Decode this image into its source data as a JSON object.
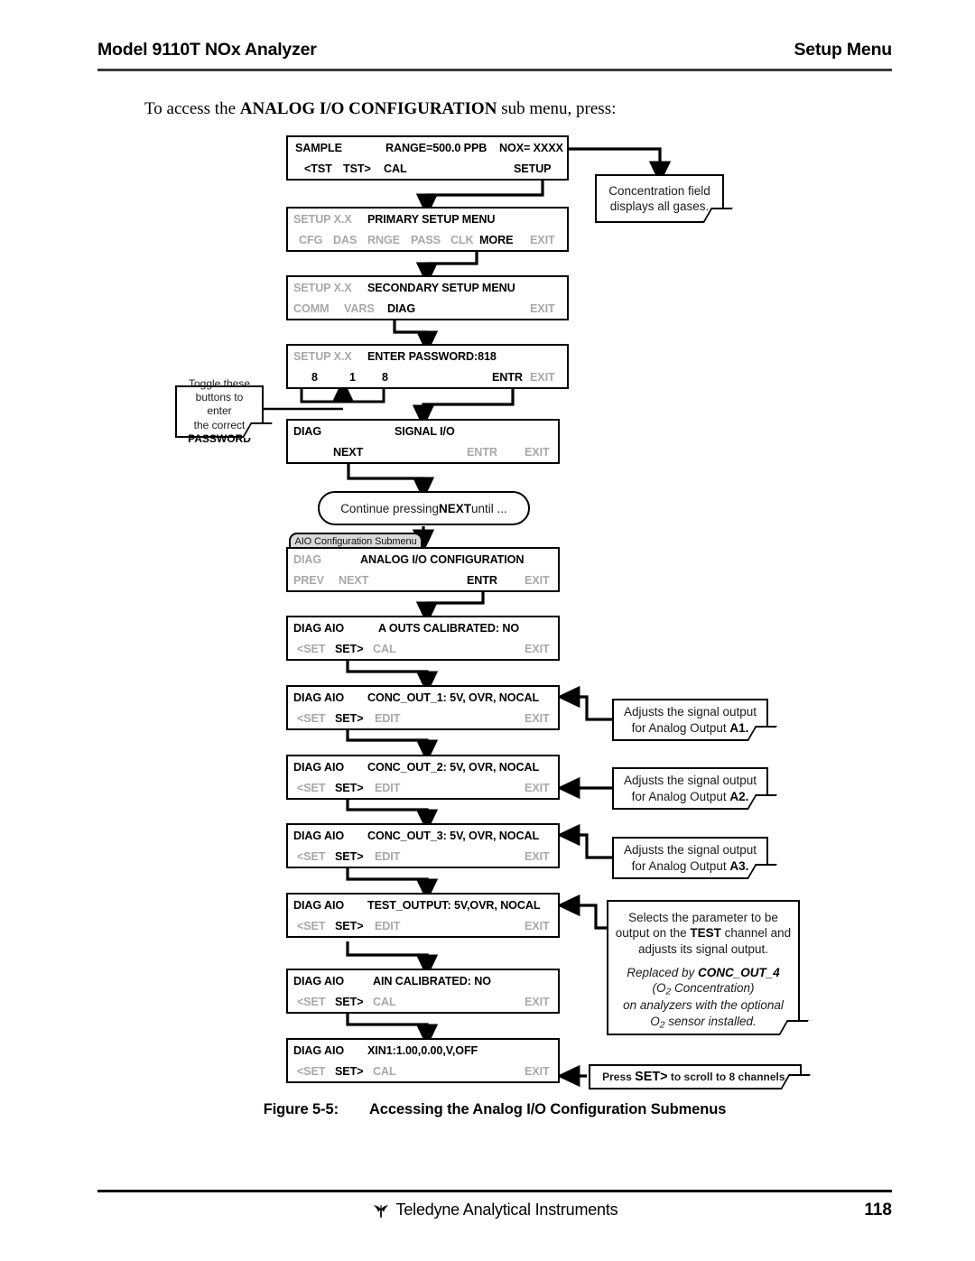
{
  "header": {
    "left_title": "Model 9110T NOx Analyzer",
    "right_title": "Setup Menu"
  },
  "intro": {
    "before": "To access the ",
    "emphasis": "ANALOG I/O CONFIGURATION",
    "after": " sub menu, press:"
  },
  "panels": [
    {
      "id": "sample",
      "top_left": "SAMPLE",
      "top_center": "RANGE=500.0 PPB",
      "top_right": "NOX= XXXX",
      "buttons": [
        {
          "label": "<TST",
          "state": "lit"
        },
        {
          "label": "TST>",
          "state": "lit"
        },
        {
          "label": "CAL",
          "state": "lit"
        },
        {
          "label": "SETUP",
          "state": "lit"
        }
      ]
    },
    {
      "id": "primary-setup",
      "top_left": "SETUP X.X",
      "top_center": "PRIMARY SETUP MENU",
      "buttons": [
        {
          "label": "CFG",
          "state": "dim"
        },
        {
          "label": "DAS",
          "state": "dim"
        },
        {
          "label": "RNGE",
          "state": "dim"
        },
        {
          "label": "PASS",
          "state": "dim"
        },
        {
          "label": "CLK",
          "state": "dim"
        },
        {
          "label": "MORE",
          "state": "lit"
        },
        {
          "label": "EXIT",
          "state": "dim"
        }
      ]
    },
    {
      "id": "secondary-setup",
      "top_left": "SETUP X.X",
      "top_center": "SECONDARY SETUP MENU",
      "buttons": [
        {
          "label": "COMM",
          "state": "dim"
        },
        {
          "label": "VARS",
          "state": "dim"
        },
        {
          "label": "DIAG",
          "state": "lit"
        },
        {
          "label": "EXIT",
          "state": "dim"
        }
      ]
    },
    {
      "id": "enter-password",
      "top_left": "SETUP X.X",
      "top_center": "ENTER PASSWORD:818",
      "digits": [
        "8",
        "1",
        "8"
      ],
      "buttons": [
        {
          "label": "ENTR",
          "state": "lit"
        },
        {
          "label": "EXIT",
          "state": "dim"
        }
      ]
    },
    {
      "id": "signal-io",
      "top_left": "DIAG",
      "top_center": "SIGNAL I/O",
      "buttons": [
        {
          "label": "NEXT",
          "state": "lit"
        },
        {
          "label": "ENTR",
          "state": "dim"
        },
        {
          "label": "EXIT",
          "state": "dim"
        }
      ]
    },
    {
      "id": "analog-io-config",
      "top_left": "DIAG",
      "top_center": "ANALOG I/O CONFIGURATION",
      "tab_label": "AIO Configuration Submenu",
      "buttons": [
        {
          "label": "PREV",
          "state": "dim"
        },
        {
          "label": "NEXT",
          "state": "dim"
        },
        {
          "label": "ENTR",
          "state": "lit"
        },
        {
          "label": "EXIT",
          "state": "dim"
        }
      ]
    },
    {
      "id": "a-outs-calibrated",
      "top_left": "DIAG AIO",
      "top_center": "A OUTS CALIBRATED: NO",
      "buttons": [
        {
          "label": "<SET",
          "state": "dim"
        },
        {
          "label": "SET>",
          "state": "lit"
        },
        {
          "label": "CAL",
          "state": "dim"
        },
        {
          "label": "EXIT",
          "state": "dim"
        }
      ]
    },
    {
      "id": "conc-out-1",
      "top_left": "DIAG AIO",
      "top_center": "CONC_OUT_1: 5V, OVR, NOCAL",
      "buttons": [
        {
          "label": "<SET",
          "state": "dim"
        },
        {
          "label": "SET>",
          "state": "lit"
        },
        {
          "label": "EDIT",
          "state": "dim"
        },
        {
          "label": "EXIT",
          "state": "dim"
        }
      ]
    },
    {
      "id": "conc-out-2",
      "top_left": "DIAG AIO",
      "top_center": "CONC_OUT_2: 5V, OVR, NOCAL",
      "buttons": [
        {
          "label": "<SET",
          "state": "dim"
        },
        {
          "label": "SET>",
          "state": "lit"
        },
        {
          "label": "EDIT",
          "state": "dim"
        },
        {
          "label": "EXIT",
          "state": "dim"
        }
      ]
    },
    {
      "id": "conc-out-3",
      "top_left": "DIAG AIO",
      "top_center": "CONC_OUT_3: 5V, OVR, NOCAL",
      "buttons": [
        {
          "label": "<SET",
          "state": "dim"
        },
        {
          "label": "SET>",
          "state": "lit"
        },
        {
          "label": "EDIT",
          "state": "dim"
        },
        {
          "label": "EXIT",
          "state": "dim"
        }
      ]
    },
    {
      "id": "test-output",
      "top_left": "DIAG AIO",
      "top_center": "TEST_OUTPUT: 5V,OVR, NOCAL",
      "buttons": [
        {
          "label": "<SET",
          "state": "dim"
        },
        {
          "label": "SET>",
          "state": "lit"
        },
        {
          "label": "EDIT",
          "state": "dim"
        },
        {
          "label": "EXIT",
          "state": "dim"
        }
      ]
    },
    {
      "id": "ain-calibrated",
      "top_left": "DIAG AIO",
      "top_center": "AIN CALIBRATED: NO",
      "buttons": [
        {
          "label": "<SET",
          "state": "dim"
        },
        {
          "label": "SET>",
          "state": "lit"
        },
        {
          "label": "CAL",
          "state": "dim"
        },
        {
          "label": "EXIT",
          "state": "dim"
        }
      ]
    },
    {
      "id": "xin1",
      "top_left": "DIAG AIO",
      "top_center": "XIN1:1.00,0.00,V,OFF",
      "buttons": [
        {
          "label": "<SET",
          "state": "dim"
        },
        {
          "label": "SET>",
          "state": "lit"
        },
        {
          "label": "CAL",
          "state": "dim"
        },
        {
          "label": "EXIT",
          "state": "dim"
        }
      ]
    }
  ],
  "notes": {
    "concentration_field": {
      "line1": "Concentration field",
      "line2": "displays all gases."
    },
    "password": {
      "line1": "Toggle these",
      "line2": "buttons to enter",
      "line3": "the correct",
      "line4": "PASSWORD"
    },
    "continue_pill": {
      "before": "Continue pressing ",
      "emphasis": "NEXT",
      "after": " until ..."
    },
    "a1": {
      "line1": "Adjusts the signal output",
      "line2_before": "for Analog Output ",
      "line2_emphasis": "A1."
    },
    "a2": {
      "line1": "Adjusts the signal output",
      "line2_before": "for Analog Output ",
      "line2_emphasis": "A2."
    },
    "a3": {
      "line1": "Adjusts the signal output",
      "line2_before": "for Analog Output ",
      "line2_emphasis": "A3."
    },
    "test_channel": {
      "line1": "Selects the parameter to be",
      "line2_before": "output on the ",
      "line2_emphasis": "TEST",
      "line2_after": " channel and",
      "line3": "adjusts its signal output.",
      "ital1_before": "Replaced by ",
      "ital1_emphasis": "CONC_OUT_4",
      "ital2_pre": "(O",
      "ital2_sub": "2",
      "ital2_post": " Concentration)",
      "ital3": "on analyzers with the optional",
      "ital4_pre": "O",
      "ital4_sub": "2",
      "ital4_post": " sensor installed."
    },
    "scroll_channels": {
      "before": "Press ",
      "emphasis": "SET>",
      "after": " to scroll to 8 channels."
    }
  },
  "figure": {
    "number": "Figure 5-5:",
    "title": "Accessing the Analog I/O Configuration Submenus"
  },
  "footer": {
    "company": "Teledyne Analytical Instruments",
    "page_number": "118",
    "logo_icon": "teledyne-bird-icon"
  }
}
